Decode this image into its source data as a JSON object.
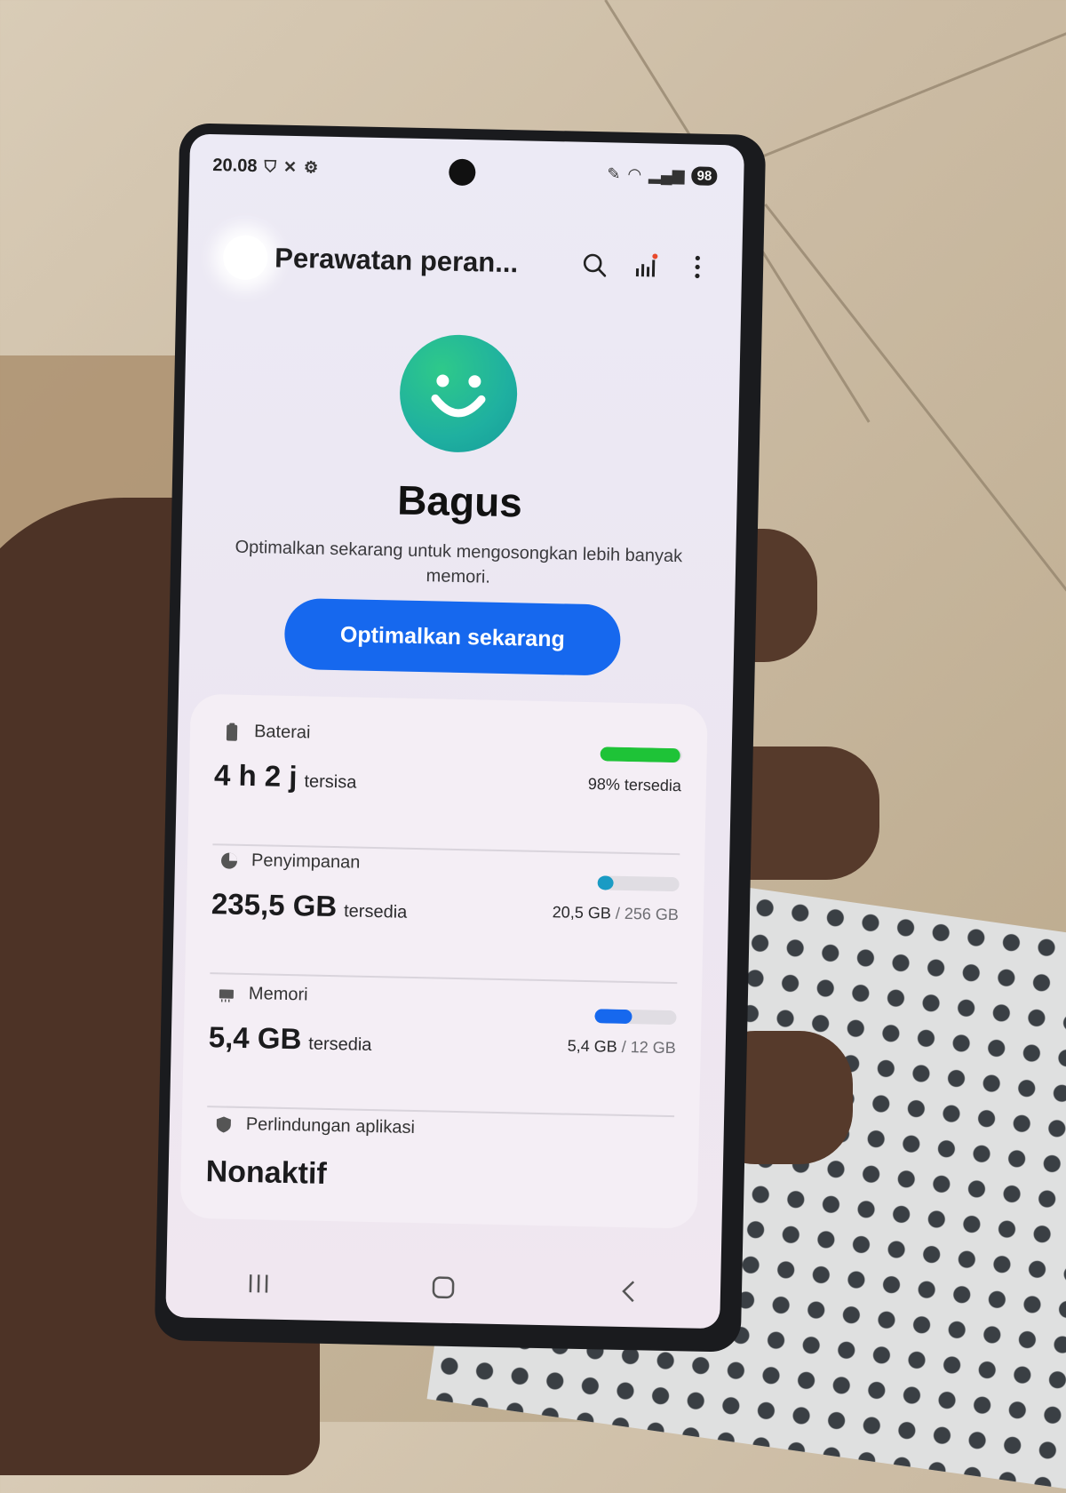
{
  "status_bar": {
    "time": "20.08",
    "battery": "98"
  },
  "app_bar": {
    "title": "Perawatan peran..."
  },
  "summary": {
    "status": "Bagus",
    "description": "Optimalkan sekarang untuk mengosongkan lebih banyak memori.",
    "optimize_button": "Optimalkan sekarang"
  },
  "battery": {
    "label": "Baterai",
    "value": "4 h 2 j",
    "unit": "tersisa",
    "available": "98% tersedia",
    "level": 0.98,
    "bar_color": "#1ec337"
  },
  "storage": {
    "label": "Penyimpanan",
    "value": "235,5 GB",
    "unit": "tersedia",
    "used": "20,5 GB",
    "total": "/ 256 GB",
    "bar_color": "#1a9bc4"
  },
  "memory": {
    "label": "Memori",
    "value": "5,4 GB",
    "unit": "tersedia",
    "used": "5,4 GB",
    "total": "/ 12 GB",
    "bar_color": "#1668ee"
  },
  "protection": {
    "label": "Perlindungan aplikasi",
    "value": "Nonaktif"
  },
  "colors": {
    "accent": "#1668ee",
    "face": "#1fb0a0"
  }
}
